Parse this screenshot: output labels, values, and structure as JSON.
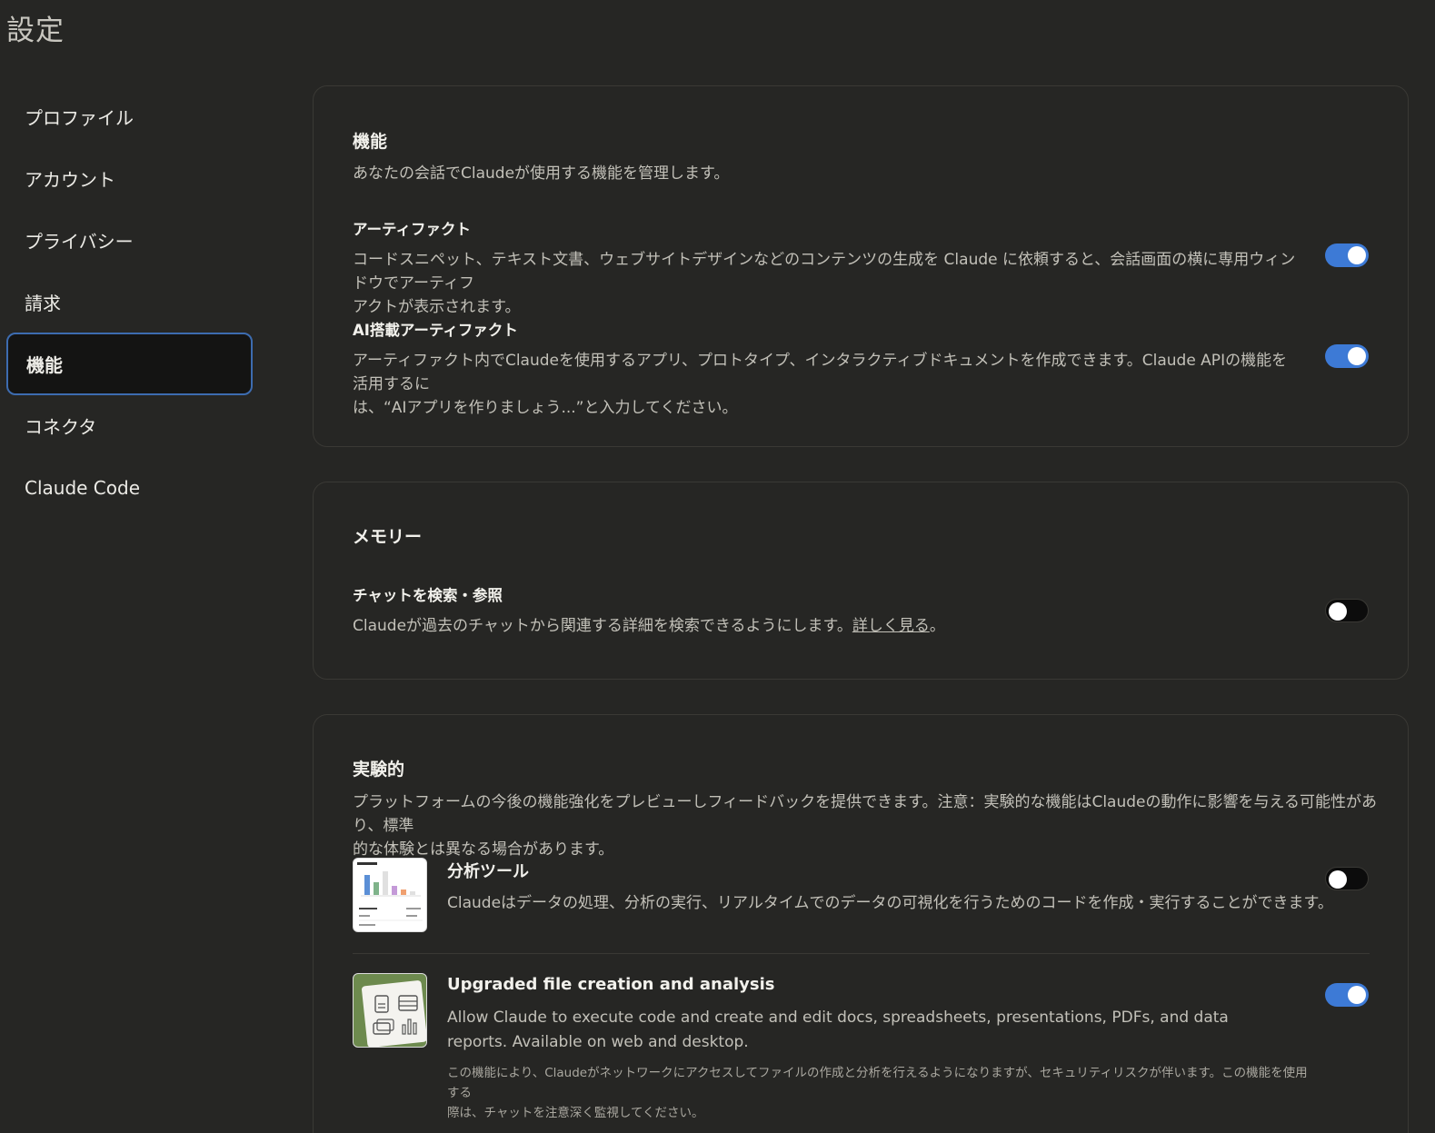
{
  "page": {
    "title": "設定"
  },
  "sidebar": {
    "items": [
      {
        "label": "プロファイル"
      },
      {
        "label": "アカウント"
      },
      {
        "label": "プライバシー"
      },
      {
        "label": "請求"
      },
      {
        "label": "機能",
        "active": true
      },
      {
        "label": "コネクタ"
      },
      {
        "label": "Claude Code"
      }
    ]
  },
  "features": {
    "title": "機能",
    "description": "あなたの会話でClaudeが使用する機能を管理します。",
    "settings": [
      {
        "title": "アーティファクト",
        "description_line1": "コードスニペット、テキスト文書、ウェブサイトデザインなどのコンテンツの生成を Claude に依頼すると、会話画面の横に専用ウィンドウでアーティフ",
        "description_line2": "アクトが表示されます。",
        "enabled": true
      },
      {
        "title": "AI搭載アーティファクト",
        "description_line1": "アーティファクト内でClaudeを使用するアプリ、プロトタイプ、インタラクティブドキュメントを作成できます。Claude APIの機能を活用するに",
        "description_line2": "は、“AIアプリを作りましょう...”と入力してください。",
        "enabled": true
      }
    ]
  },
  "memory": {
    "title": "メモリー",
    "settings": [
      {
        "title": "チャットを検索・参照",
        "description": "Claudeが過去のチャットから関連する詳細を検索できるようにします。",
        "link": "詳しく見る",
        "suffix": "。",
        "enabled": false
      }
    ]
  },
  "experimental": {
    "title": "実験的",
    "description_line1": "プラットフォームの今後の機能強化をプレビューしフィードバックを提供できます。注意：実験的な機能はClaudeの動作に影響を与える可能性があり、標準",
    "description_line2": "的な体験とは異なる場合があります。",
    "tools": [
      {
        "title": "分析ツール",
        "description": "Claudeはデータの処理、分析の実行、リアルタイムでのデータの可視化を行うためのコードを作成・実行することができます。",
        "enabled": false,
        "icon": "analysis-thumbnail"
      },
      {
        "title": "Upgraded file creation and analysis",
        "description_line1": "Allow Claude to execute code and create and edit docs, spreadsheets, presentations, PDFs, and data",
        "description_line2": "reports. Available on web and desktop.",
        "note_line1": "この機能により、Claudeがネットワークにアクセスしてファイルの作成と分析を行えるようになりますが、セキュリティリスクが伴います。この機能を使用する",
        "note_line2": "際は、チャットを注意深く監視してください。",
        "enabled": true,
        "icon": "file-creation-thumbnail"
      }
    ]
  },
  "colors": {
    "background": "#262624",
    "toggle_on": "#3d7ad6",
    "active_border": "#3d6cb0"
  }
}
